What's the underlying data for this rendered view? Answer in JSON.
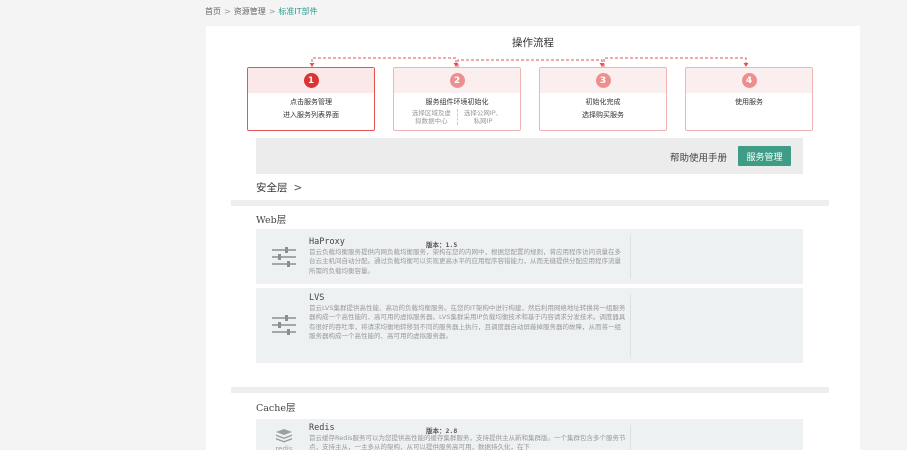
{
  "breadcrumb": {
    "home": "首页",
    "resources": "资源管理",
    "current": "标准IT部件",
    "separator": ">"
  },
  "flow": {
    "title": "操作流程",
    "steps": [
      {
        "num": "1",
        "line1": "点击服务管理",
        "line2": "进入服务列表界面"
      },
      {
        "num": "2",
        "line1": "服务组件环境初始化",
        "sub_left": [
          "选择区域及虚",
          "拟数据中心"
        ],
        "sub_right": [
          "选择公网IP、",
          "私网IP"
        ]
      },
      {
        "num": "3",
        "line1": "初始化完成",
        "line2": "选择购买服务"
      },
      {
        "num": "4",
        "line1": "使用服务"
      }
    ]
  },
  "help": {
    "manual_label": "帮助使用手册",
    "service_button": "服务管理"
  },
  "security": {
    "title": "安全层",
    "chevron": ">"
  },
  "web": {
    "title": "Web层",
    "items": [
      {
        "name": "HaProxy",
        "version": "版本：1.5",
        "icon": "sliders-icon",
        "desc": "首云负载均衡服务提供内网负载均衡服务，架构在您的内网中，根据您配置的规则，将应用程序访问流量在多台云主机间自动分配。通过负载均衡可以实现更高水平的应用程序容错能力，从而无缝提供分配应用程序流量所需的负载均衡容量。"
      },
      {
        "name": "LVS",
        "version": "",
        "icon": "sliders-icon",
        "desc": "首云LVS集群提供高性能、高功的负载均衡服务。在您的IT架构中进行构建，然后利用网络地址转换将一组服务器构成一个高性能的、高可用的虚拟服务器。LVS集群采用IP负载均衡技术和基于内容请求分发技术。调度器具有很好的吞吐率，将请求均衡地转移到不同的服务器上执行，且调度器自动屏蔽掉服务器的故障，从而将一组服务器构成一个高性能的、高可用的虚拟服务器。"
      }
    ]
  },
  "cache": {
    "title": "Cache层",
    "items": [
      {
        "name": "Redis",
        "version": "版本：2.8",
        "icon": "redis-icon",
        "icon_text": "redis",
        "desc": "首云缓存Redis服务可以为您提供高性能的缓存集群服务，支持提供主从新和集群版。一个集群包含多个服务节点，支持主从，一主多从的架构，从可以提供服务高可用，数据持久化，在下"
      }
    ]
  },
  "colors": {
    "accent": "#3f9c86",
    "step_active": "#dd3333",
    "step_inactive": "#ee8f8f"
  }
}
